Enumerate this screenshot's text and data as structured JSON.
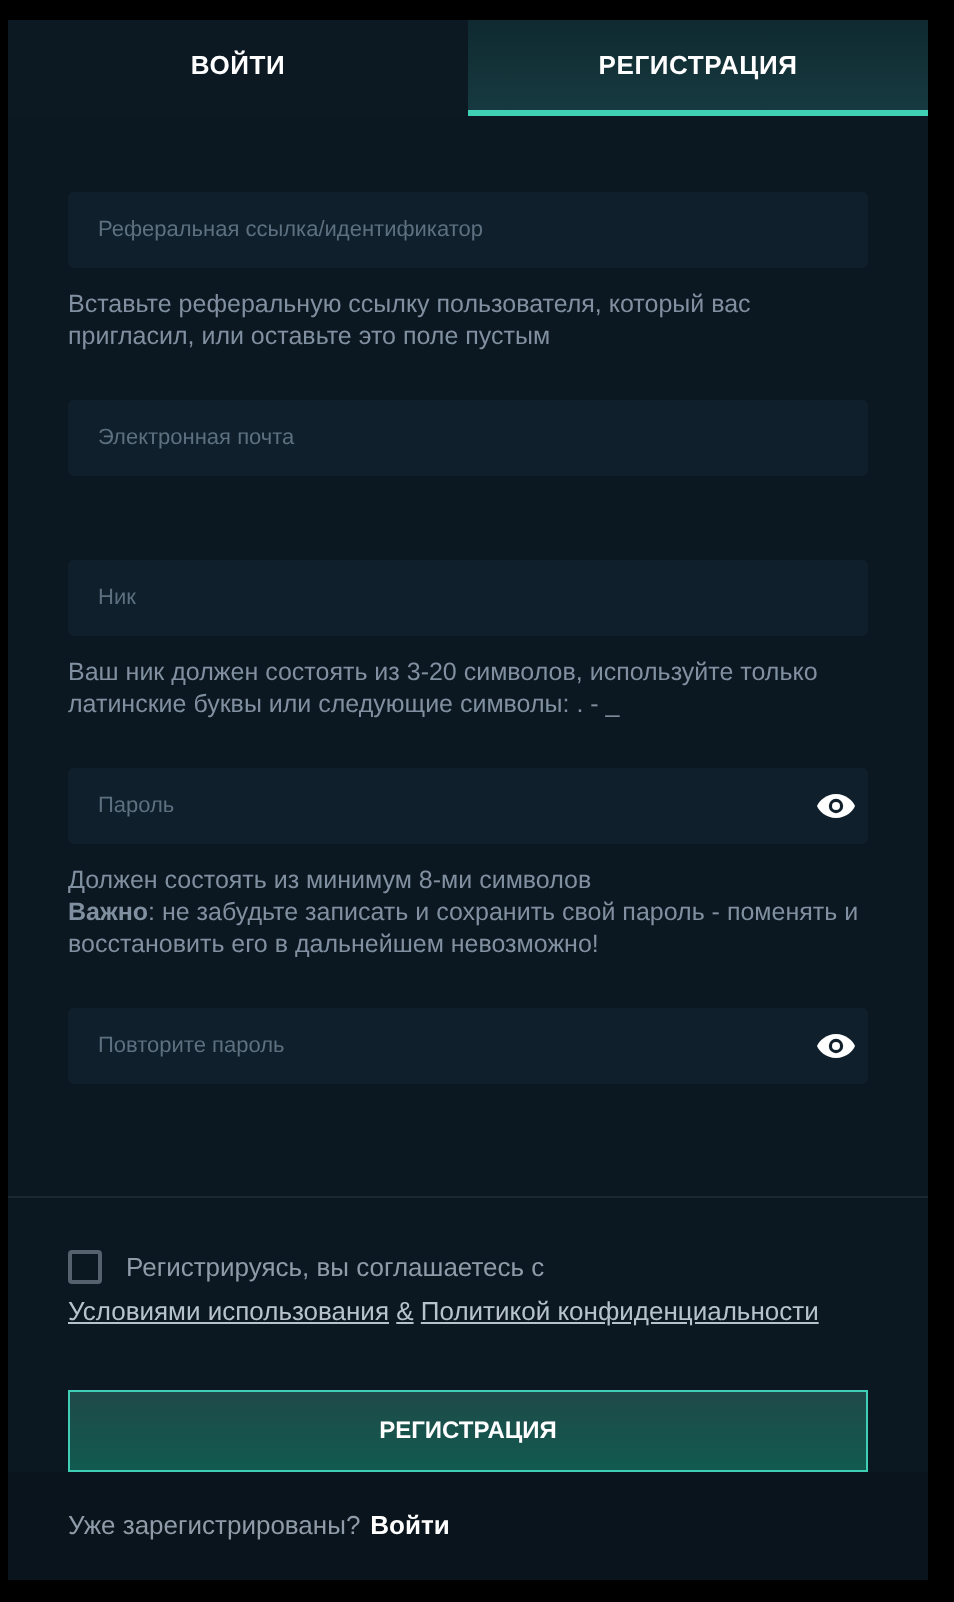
{
  "tabs": [
    {
      "label": "ВОЙТИ",
      "selected": false
    },
    {
      "label": "РЕГИСТРАЦИЯ",
      "selected": true
    }
  ],
  "fields": [
    {
      "placeholder": "Реферальная ссылка/идентификатор",
      "kind": "text",
      "hint": [
        "Вставьте реферальную ссылку пользователя, который вас пригласил, или оставьте это поле пустым"
      ]
    },
    {
      "placeholder": "Электронная почта",
      "kind": "text"
    },
    {
      "placeholder": "Ник",
      "kind": "text",
      "hint": [
        "Ваш ник должен состоять из 3-20 символов, используйте только латинские буквы или следующие символы: . - _"
      ]
    },
    {
      "placeholder": "Пароль",
      "kind": "password",
      "hint": [
        "Должен состоять из минимум 8-ми символов",
        "**Важно**: не забудьте записать и сохранить свой пароль - поменять и восстановить его в дальнейшем невозможно!"
      ]
    },
    {
      "placeholder": "Повторите пароль",
      "kind": "password"
    }
  ],
  "agreement": {
    "checked": false,
    "text": "Регистрируясь, вы соглашаетесь с",
    "links": [
      "Условиями использования",
      "&",
      "Политикой конфиденциальности"
    ]
  },
  "submit": "РЕГИСТРАЦИЯ",
  "footer": {
    "text": "Уже зарегистрированы?",
    "link": "Войти"
  }
}
